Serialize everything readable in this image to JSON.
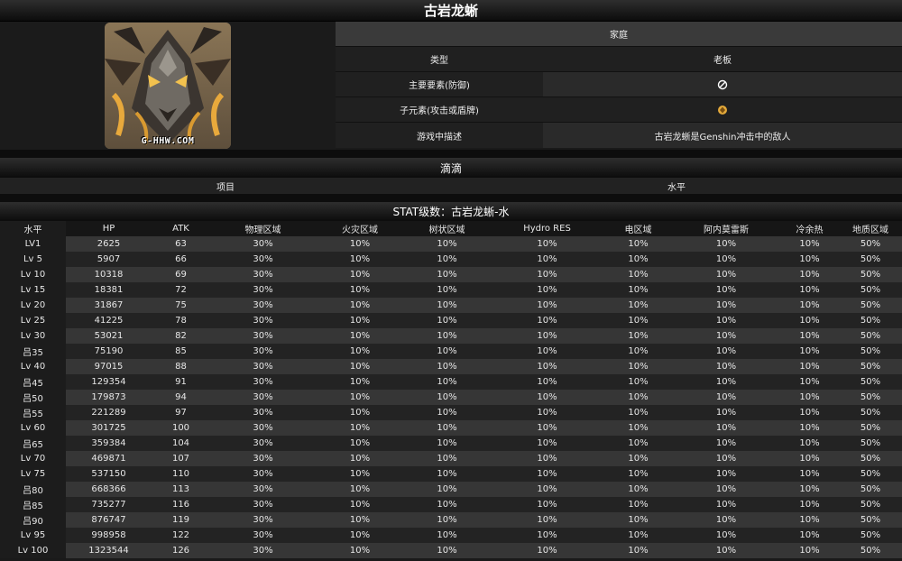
{
  "page": {
    "title": "古岩龙蜥"
  },
  "portrait": {
    "watermark": "G-HHW.COM"
  },
  "info": {
    "family_label": "家庭",
    "type_label": "类型",
    "type_value": "老板",
    "main_element_label": "主要要素(防御)",
    "sub_element_label": "子元素(攻击或盾牌)",
    "description_label": "游戏中描述",
    "description_value": "古岩龙蜥是Genshin冲击中的敌人",
    "main_element_icon": "circle-slash-icon",
    "sub_element_icon": "geo-element-icon",
    "sub_element_color": "#e3a93a"
  },
  "drops": {
    "title": "滴滴",
    "col_item": "项目",
    "col_level": "水平"
  },
  "stats": {
    "title": "STAT级数：古岩龙蜥-水",
    "columns": [
      "水平",
      "HP",
      "ATK",
      "物理区域",
      "火灾区域",
      "树状区域",
      "Hydro RES",
      "电区域",
      "阿内莫雷斯",
      "冷余热",
      "地质区域"
    ],
    "rows": [
      [
        "LV1",
        "2625",
        "63",
        "30%",
        "10%",
        "10%",
        "10%",
        "10%",
        "10%",
        "10%",
        "50%"
      ],
      [
        "Lv 5",
        "5907",
        "66",
        "30%",
        "10%",
        "10%",
        "10%",
        "10%",
        "10%",
        "10%",
        "50%"
      ],
      [
        "Lv 10",
        "10318",
        "69",
        "30%",
        "10%",
        "10%",
        "10%",
        "10%",
        "10%",
        "10%",
        "50%"
      ],
      [
        "Lv 15",
        "18381",
        "72",
        "30%",
        "10%",
        "10%",
        "10%",
        "10%",
        "10%",
        "10%",
        "50%"
      ],
      [
        "Lv 20",
        "31867",
        "75",
        "30%",
        "10%",
        "10%",
        "10%",
        "10%",
        "10%",
        "10%",
        "50%"
      ],
      [
        "Lv 25",
        "41225",
        "78",
        "30%",
        "10%",
        "10%",
        "10%",
        "10%",
        "10%",
        "10%",
        "50%"
      ],
      [
        "Lv 30",
        "53021",
        "82",
        "30%",
        "10%",
        "10%",
        "10%",
        "10%",
        "10%",
        "10%",
        "50%"
      ],
      [
        "吕35",
        "75190",
        "85",
        "30%",
        "10%",
        "10%",
        "10%",
        "10%",
        "10%",
        "10%",
        "50%"
      ],
      [
        "Lv 40",
        "97015",
        "88",
        "30%",
        "10%",
        "10%",
        "10%",
        "10%",
        "10%",
        "10%",
        "50%"
      ],
      [
        "吕45",
        "129354",
        "91",
        "30%",
        "10%",
        "10%",
        "10%",
        "10%",
        "10%",
        "10%",
        "50%"
      ],
      [
        "吕50",
        "179873",
        "94",
        "30%",
        "10%",
        "10%",
        "10%",
        "10%",
        "10%",
        "10%",
        "50%"
      ],
      [
        "吕55",
        "221289",
        "97",
        "30%",
        "10%",
        "10%",
        "10%",
        "10%",
        "10%",
        "10%",
        "50%"
      ],
      [
        "Lv 60",
        "301725",
        "100",
        "30%",
        "10%",
        "10%",
        "10%",
        "10%",
        "10%",
        "10%",
        "50%"
      ],
      [
        "吕65",
        "359384",
        "104",
        "30%",
        "10%",
        "10%",
        "10%",
        "10%",
        "10%",
        "10%",
        "50%"
      ],
      [
        "Lv 70",
        "469871",
        "107",
        "30%",
        "10%",
        "10%",
        "10%",
        "10%",
        "10%",
        "10%",
        "50%"
      ],
      [
        "Lv 75",
        "537150",
        "110",
        "30%",
        "10%",
        "10%",
        "10%",
        "10%",
        "10%",
        "10%",
        "50%"
      ],
      [
        "吕80",
        "668366",
        "113",
        "30%",
        "10%",
        "10%",
        "10%",
        "10%",
        "10%",
        "10%",
        "50%"
      ],
      [
        "吕85",
        "735277",
        "116",
        "30%",
        "10%",
        "10%",
        "10%",
        "10%",
        "10%",
        "10%",
        "50%"
      ],
      [
        "吕90",
        "876747",
        "119",
        "30%",
        "10%",
        "10%",
        "10%",
        "10%",
        "10%",
        "10%",
        "50%"
      ],
      [
        "Lv 95",
        "998958",
        "122",
        "30%",
        "10%",
        "10%",
        "10%",
        "10%",
        "10%",
        "10%",
        "50%"
      ],
      [
        "Lv 100",
        "1323544",
        "126",
        "30%",
        "10%",
        "10%",
        "10%",
        "10%",
        "10%",
        "10%",
        "50%"
      ]
    ]
  }
}
